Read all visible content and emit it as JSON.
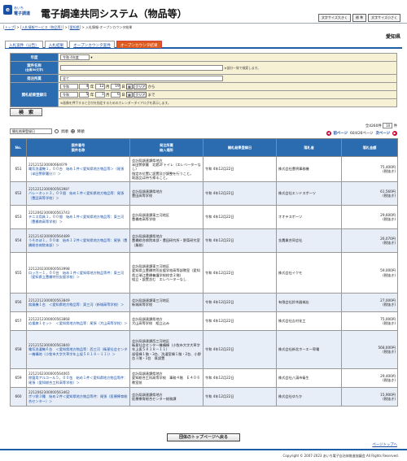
{
  "header": {
    "logo_line1": "あいち",
    "logo_line2": "電子調達",
    "title": "電子調達共同システム（物品等）",
    "size_buttons": [
      "文字サイズ大きく",
      "標 準",
      "文字サイズ小さく"
    ]
  },
  "breadcrumb": {
    "items": [
      "トップ",
      "入札情報サービス（物品等）",
      "愛知県"
    ],
    "current": "入札情報-オープンカウンタ結果"
  },
  "prefecture": "愛知県",
  "tabs": [
    {
      "label": "入札案件（公告）",
      "active": false
    },
    {
      "label": "入札結果",
      "active": false
    },
    {
      "label": "オープンカウンタ案件",
      "active": false
    },
    {
      "label": "オープンカウンタ結果",
      "active": true
    }
  ],
  "search": {
    "year_label": "年度",
    "year_value": "令和 4年度",
    "name_label": "案件名称",
    "name_label2": "(全角50文字)",
    "name_hint": "※部分一致で検索します。",
    "org_label": "発注所属",
    "org_value": "全て",
    "date_label": "開札結果登録日",
    "era1": "令和",
    "from": {
      "y": "4",
      "m": "12",
      "d": "19"
    },
    "era2": "令和",
    "to": {
      "y": "5",
      "m": "1",
      "d": "6"
    },
    "unit_y": "年",
    "unit_m": "月",
    "unit_d": "日",
    "clear": "クリア",
    "kara": "から",
    "made": "まで",
    "calendar_hint": "※画像を押下すると日付を指定するためのカレンダーダイアログを表示します。",
    "search_button": "検　索"
  },
  "sort": {
    "select_value": "開札結果登録日",
    "asc": "昇順",
    "desc": "降順"
  },
  "pager": {
    "summary": "全4260件",
    "per_page": "10",
    "per_page_unit": "件",
    "page_info": "60/426ページ",
    "prev": "前ページ",
    "next": "次ページ"
  },
  "table": {
    "headers": [
      "No.",
      "案件番号\n案件名称",
      "発注所属\n納入場所",
      "開札結果登録日",
      "落札者",
      "落札金額"
    ],
    "rows": [
      {
        "no": "651",
        "case_no": "2212152300006640?9",
        "case_name": "電気洗濯機１，００台　始め１件＜愛知県地方物品等＞（尾張（半田警察署分））＞",
        "org": "会計局調達課県地方\n半田警察署　北館2Fトイレ（エレベーターなし）\n指定の位置に設置及び調整を行うこと。\n既設品は持ち帰ること。",
        "date": "令和 4年12月22日",
        "winner": "株式会社豊明事務機",
        "amount": "75,400円",
        "tax": "(税抜き)"
      },
      {
        "no": "652",
        "case_no": "221221230000056398?",
        "case_name": "バレーネット３，００個　始め１件＜愛知県地方物品等：尾張（豊田高等学校）＞",
        "org": "会計局調達課県地方\n豊田高等学校",
        "date": "令和 4年12月22日",
        "winner": "株式会社エンドスポーツ",
        "amount": "61,560円",
        "tax": "(税抜き)"
      },
      {
        "no": "653",
        "case_no": "2212062300000563743",
        "case_name": "テニス用具１，００個　始め１件＜愛知県地方物品等：東三河（豊橋南高等学校）＞",
        "org": "会計局調達課東三河地区\n豊橋南高等学校",
        "date": "令和 4年12月22日",
        "winner": "オオテスポーツ",
        "amount": "29,600円",
        "tax": "(税抜き)"
      },
      {
        "no": "654",
        "case_no": "2212142300000564489",
        "case_name": "うそのぼ１，００本　始め１２件＜愛知県地方物品等：尾張（豊橋総合病院本部）＞",
        "org": "会計局調達課県地方\n豊橋総合病院本部・豊田研究所・野菜研究室（業務）",
        "date": "令和 4年12月22日",
        "winner": "金農業合同会社",
        "amount": "26,070円",
        "tax": "(税抜き)"
      },
      {
        "no": "655",
        "case_no": "2212202300000563998",
        "case_name": "ロッカー１，００台　始め１件＜愛知県地方物品等件：東三河（愛知県立豊橋特別支援学校）＞",
        "org": "会計局調達課東三河地区\n愛知県立豊橋特別支援学校高等部教室（愛知県立瑞江豊橋養護学校校舎２階）\n組立・設置含む　エレベーターなし",
        "date": "令和 4年12月22日",
        "winner": "株式会社イクモ",
        "amount": "59,000円",
        "tax": "(税抜き)"
      },
      {
        "no": "656",
        "case_no": "2212212300000563849",
        "case_name": "扇風機１台　＜愛知県地方物品等：東三河（新城高等学校）＞",
        "org": "会計局調達課東三河地区\n新城高等学校",
        "date": "令和 4年12月22日",
        "winner": "有限会社鈴木器械店",
        "amount": "27,000円",
        "tax": "(税抜き)"
      },
      {
        "no": "657",
        "case_no": "2212212300000563868",
        "case_name": "応援旗１セット　＜愛知県地方物品等：尾張（大山高等学校）＞",
        "org": "会計局調達課県地方\n犬山高等学校　組立込み",
        "date": "令和 4年12月22日",
        "winner": "株式会社吉村化工",
        "amount": "75,000円",
        "tax": "(税抜き)"
      },
      {
        "no": "658",
        "case_no": "2212152300000563840",
        "case_name": "電気洗濯機６台　＜愛知県地方物品等：西三河（衛星社会センター機構地（小牧市大字大草字年上坂５８１８－１１））＞",
        "org": "会計局調達課西三河地区\n衛星社会センター機構棟（小牧市大字大草字年上坂５８１８－１１）\n留宿棟１階・3台、洗濯室棟１階・2台、小野台１階・1台　既設置",
        "date": "令和 4年12月22日",
        "winner": "株式会社新北ホーエー寄電",
        "amount": "568,000円",
        "tax": "(税抜き)"
      },
      {
        "no": "659",
        "case_no": "2212162300000564065",
        "case_name": "除菌用アルコール５，００缶　始め１件＜愛知県地方物品等件：尾張（愛知総合工科高等学校）＞",
        "org": "会計局調達課県地方\n愛知総合工科高等学校　事務４階　Ｅ４０６　教室前",
        "date": "令和 4年12月22日",
        "winner": "株式会社八滿市衛生",
        "amount": "29,400円",
        "tax": "(税抜き)"
      },
      {
        "no": "660",
        "case_no": "2212062300000563462",
        "case_name": "ポリ袋３種　始め２件＜愛知県地方物品等件：尾張（医療療育総合センター）＞",
        "org": "会計局調達課県地方\n医療療育総合センター総務課",
        "date": "令和 4年12月22日",
        "winner": "株式会社ゆたか",
        "amount": "15,900円",
        "tax": "(税抜き)"
      }
    ]
  },
  "bottom_button": "団体のトップページへ戻る",
  "page_top": "ページトップへ",
  "footer": "Copyright © 2007-2023 あいち電子自治体推進協議会 All Rights Reserved."
}
